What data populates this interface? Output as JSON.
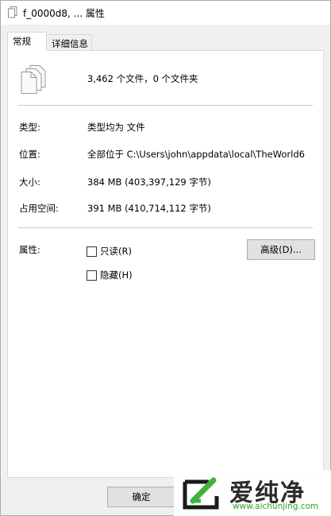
{
  "window": {
    "title": "f_0000d8, ... 属性"
  },
  "tabs": [
    {
      "label": "常规",
      "active": true
    },
    {
      "label": "详细信息",
      "active": false
    }
  ],
  "summary": "3,462 个文件，0 个文件夹",
  "fields": {
    "type": {
      "label": "类型:",
      "value": "类型均为 文件"
    },
    "location": {
      "label": "位置:",
      "value": "全部位于 C:\\Users\\john\\appdata\\local\\TheWorld6"
    },
    "size": {
      "label": "大小:",
      "value": "384 MB (403,397,129 字节)"
    },
    "size_on_disk": {
      "label": "占用空间:",
      "value": "391 MB (410,714,112 字节)"
    }
  },
  "attributes": {
    "label": "属性:",
    "readonly": {
      "label": "只读(R)",
      "checked": false
    },
    "hidden": {
      "label": "隐藏(H)",
      "checked": false
    },
    "advanced_button": "高级(D)..."
  },
  "buttons": {
    "ok": "确定"
  },
  "watermark": {
    "title": "爱纯净",
    "url": "www.aichunjing.com"
  },
  "colors": {
    "window_bg": "#f0f0f0",
    "panel_bg": "#ffffff",
    "watermark_green": "#2aa52a"
  },
  "icons": {
    "title": "file-stack-icon",
    "main": "multiple-files-icon",
    "watermark_logo": "aichunjing-logo-icon"
  }
}
